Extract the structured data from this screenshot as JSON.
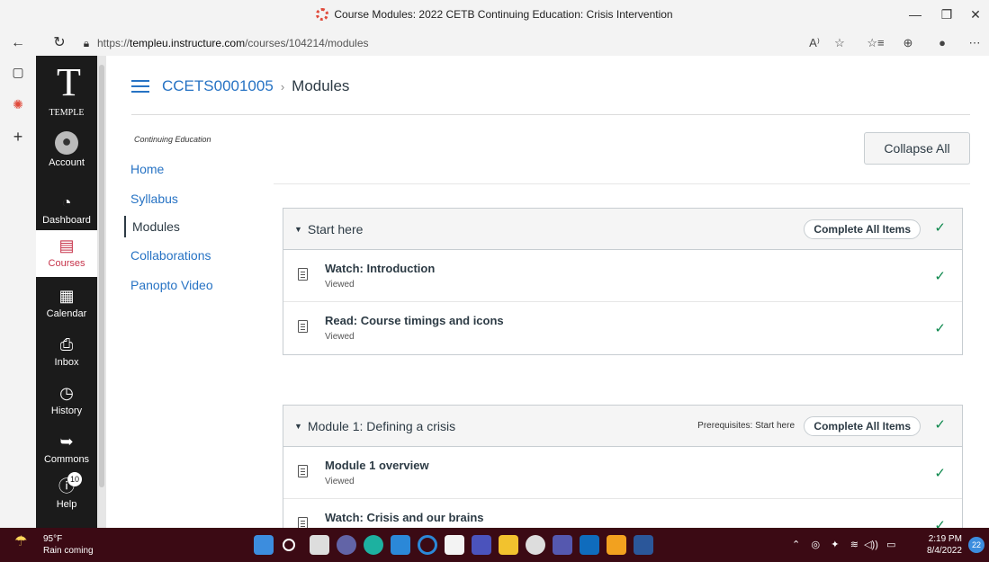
{
  "browser": {
    "tab_title": "Course Modules: 2022 CETB Continuing Education: Crisis Intervention",
    "url_prefix": "https://",
    "url_host": "templeu.instructure.com",
    "url_path": "/courses/104214/modules"
  },
  "global_nav": {
    "logo_text": "TEMPLE",
    "items": [
      {
        "label": "Account",
        "icon": "account-icon"
      },
      {
        "label": "Dashboard",
        "icon": "dashboard-icon"
      },
      {
        "label": "Courses",
        "icon": "courses-icon"
      },
      {
        "label": "Calendar",
        "icon": "calendar-icon"
      },
      {
        "label": "Inbox",
        "icon": "inbox-icon"
      },
      {
        "label": "History",
        "icon": "history-icon"
      },
      {
        "label": "Commons",
        "icon": "commons-icon"
      },
      {
        "label": "Help",
        "icon": "help-icon"
      }
    ],
    "help_badge": "10"
  },
  "header": {
    "course_code": "CCETS0001005",
    "current": "Modules"
  },
  "course_nav": {
    "subtitle": "Continuing Education",
    "items": [
      "Home",
      "Syllabus",
      "Modules",
      "Collaborations",
      "Panopto Video"
    ]
  },
  "toolbar": {
    "collapse_all": "Collapse All"
  },
  "modules": [
    {
      "title": "Start here",
      "prereq": "",
      "complete_label": "Complete All Items",
      "items": [
        {
          "title": "Watch: Introduction",
          "status": "Viewed"
        },
        {
          "title": "Read: Course timings and icons",
          "status": "Viewed"
        }
      ]
    },
    {
      "title": "Module 1: Defining a crisis",
      "prereq": "Prerequisites: Start here",
      "complete_label": "Complete All Items",
      "items": [
        {
          "title": "Module 1 overview",
          "status": "Viewed"
        },
        {
          "title": "Watch: Crisis and our brains",
          "status": ""
        }
      ]
    }
  ],
  "taskbar": {
    "temp": "95°F",
    "weather": "Rain coming",
    "time": "2:19 PM",
    "date": "8/4/2022",
    "notifications": "22"
  },
  "colors": {
    "link": "#2773c4",
    "nav_bg": "#1b1b1b",
    "brand_red": "#c7344b",
    "success": "#0b874b",
    "taskbar": "#3b0a14"
  }
}
